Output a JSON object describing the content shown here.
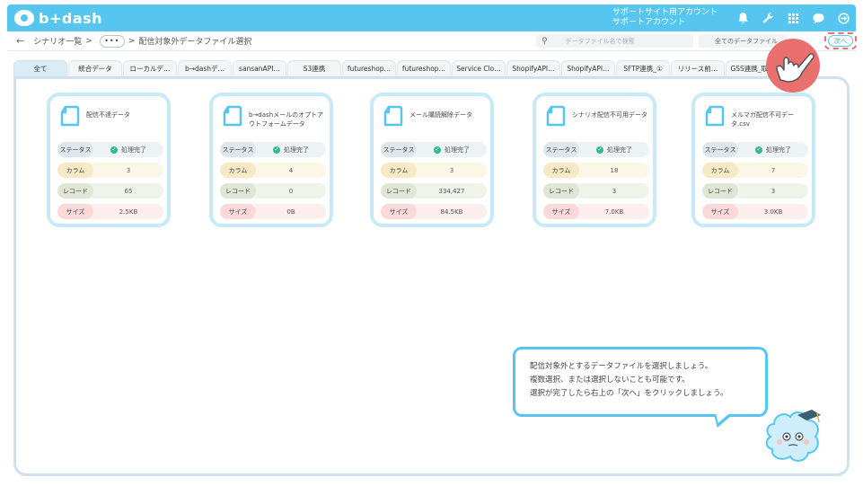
{
  "app": {
    "logo_text": "b+dash"
  },
  "header": {
    "account_line1": "サポートサイト用アカウント",
    "account_line2": "サポートアカウント",
    "icons": [
      "bell-icon",
      "wrench-icon",
      "grid-icon",
      "chat-icon",
      "logout-icon"
    ]
  },
  "breadcrumb": {
    "back": "←",
    "root": "シナリオ一覧",
    "sep1": ">",
    "ellipsis": "•••",
    "sep2": ">",
    "current": "配信対象外データファイル選択"
  },
  "search": {
    "placeholder": "データファイル名で検索"
  },
  "filter": {
    "label": "全てのデータファイル"
  },
  "next_button": {
    "label": "次へ"
  },
  "tabs": [
    {
      "label": "全て"
    },
    {
      "label": "統合データ"
    },
    {
      "label": "ローカルデ…"
    },
    {
      "label": "b→dashデ…"
    },
    {
      "label": "sansanAPI…"
    },
    {
      "label": "S3連携"
    },
    {
      "label": "futureshop…"
    },
    {
      "label": "futureshop…"
    },
    {
      "label": "Service Clo…"
    },
    {
      "label": "ShopifyAPI…"
    },
    {
      "label": "ShopifyAPI…"
    },
    {
      "label": "SFTP連携_①"
    },
    {
      "label": "リリース前…"
    },
    {
      "label": "GSS連携_取…"
    }
  ],
  "row_labels": {
    "status": "ステータス",
    "columns": "カラム",
    "records": "レコード",
    "size": "サイズ"
  },
  "cards": [
    {
      "title": "配信不達データ",
      "status": "処理完了",
      "columns": "3",
      "records": "65",
      "size": "2.5KB"
    },
    {
      "title": "b→dashメールのオプトアウトフォームデータ",
      "status": "処理完了",
      "columns": "4",
      "records": "0",
      "size": "0B"
    },
    {
      "title": "メール購読解除データ",
      "status": "処理完了",
      "columns": "3",
      "records": "334,427",
      "size": "84.5KB"
    },
    {
      "title": "シナリオ配信不可用データ",
      "status": "処理完了",
      "columns": "18",
      "records": "3",
      "size": "7.0KB"
    },
    {
      "title": "メルマガ配信不可データ.csv",
      "status": "処理完了",
      "columns": "7",
      "records": "3",
      "size": "3.0KB"
    }
  ],
  "tooltip": {
    "line1": "配信対象外とするデータファイルを選択しましょう。",
    "line2": "複数選択、または選択しないことも可能です。",
    "line3": "選択が完了したら右上の「次へ」をクリックしましょう。"
  },
  "colors": {
    "brand": "#56c6f0",
    "status_ok": "#32b98a",
    "highlight": "#e9706f"
  }
}
